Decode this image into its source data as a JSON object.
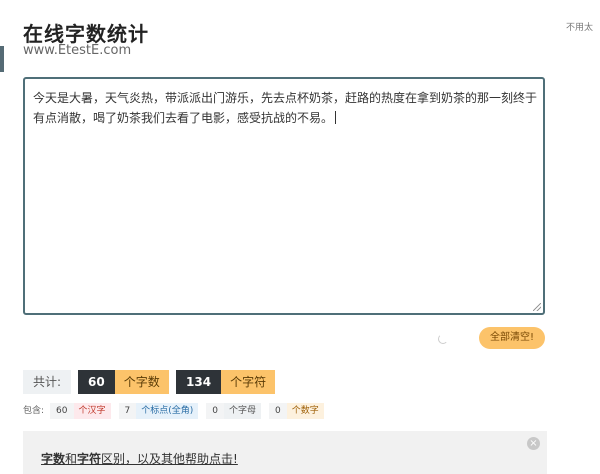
{
  "header": {
    "title": "在线字数统计",
    "subtitle": "www.EtestE.com",
    "side_note": "不用太"
  },
  "editor": {
    "text": "今天是大暑，天气炎热，带派派出门游乐，先去点杯奶茶，赶路的热度在拿到奶茶的那一刻终于有点消散，喝了奶茶我们去看了电影，感受抗战的不易。"
  },
  "actions": {
    "clear_label": "全部清空!"
  },
  "stats": {
    "total_label": "共计:",
    "chars_count": "60",
    "chars_unit": "个字数",
    "symbols_count": "134",
    "symbols_unit": "个字符"
  },
  "details": {
    "label": "包含:",
    "hanzi_count": "60",
    "hanzi_unit": "个汉字",
    "punct_count": "7",
    "punct_unit": "个标点(全角)",
    "letter_count": "0",
    "letter_unit": "个字母",
    "digit_count": "0",
    "digit_unit": "个数字"
  },
  "help": {
    "part1": "字数",
    "part2": "和",
    "part3": "字符",
    "part4": "区别，以及其他帮助点击!",
    "close_icon": "×"
  }
}
